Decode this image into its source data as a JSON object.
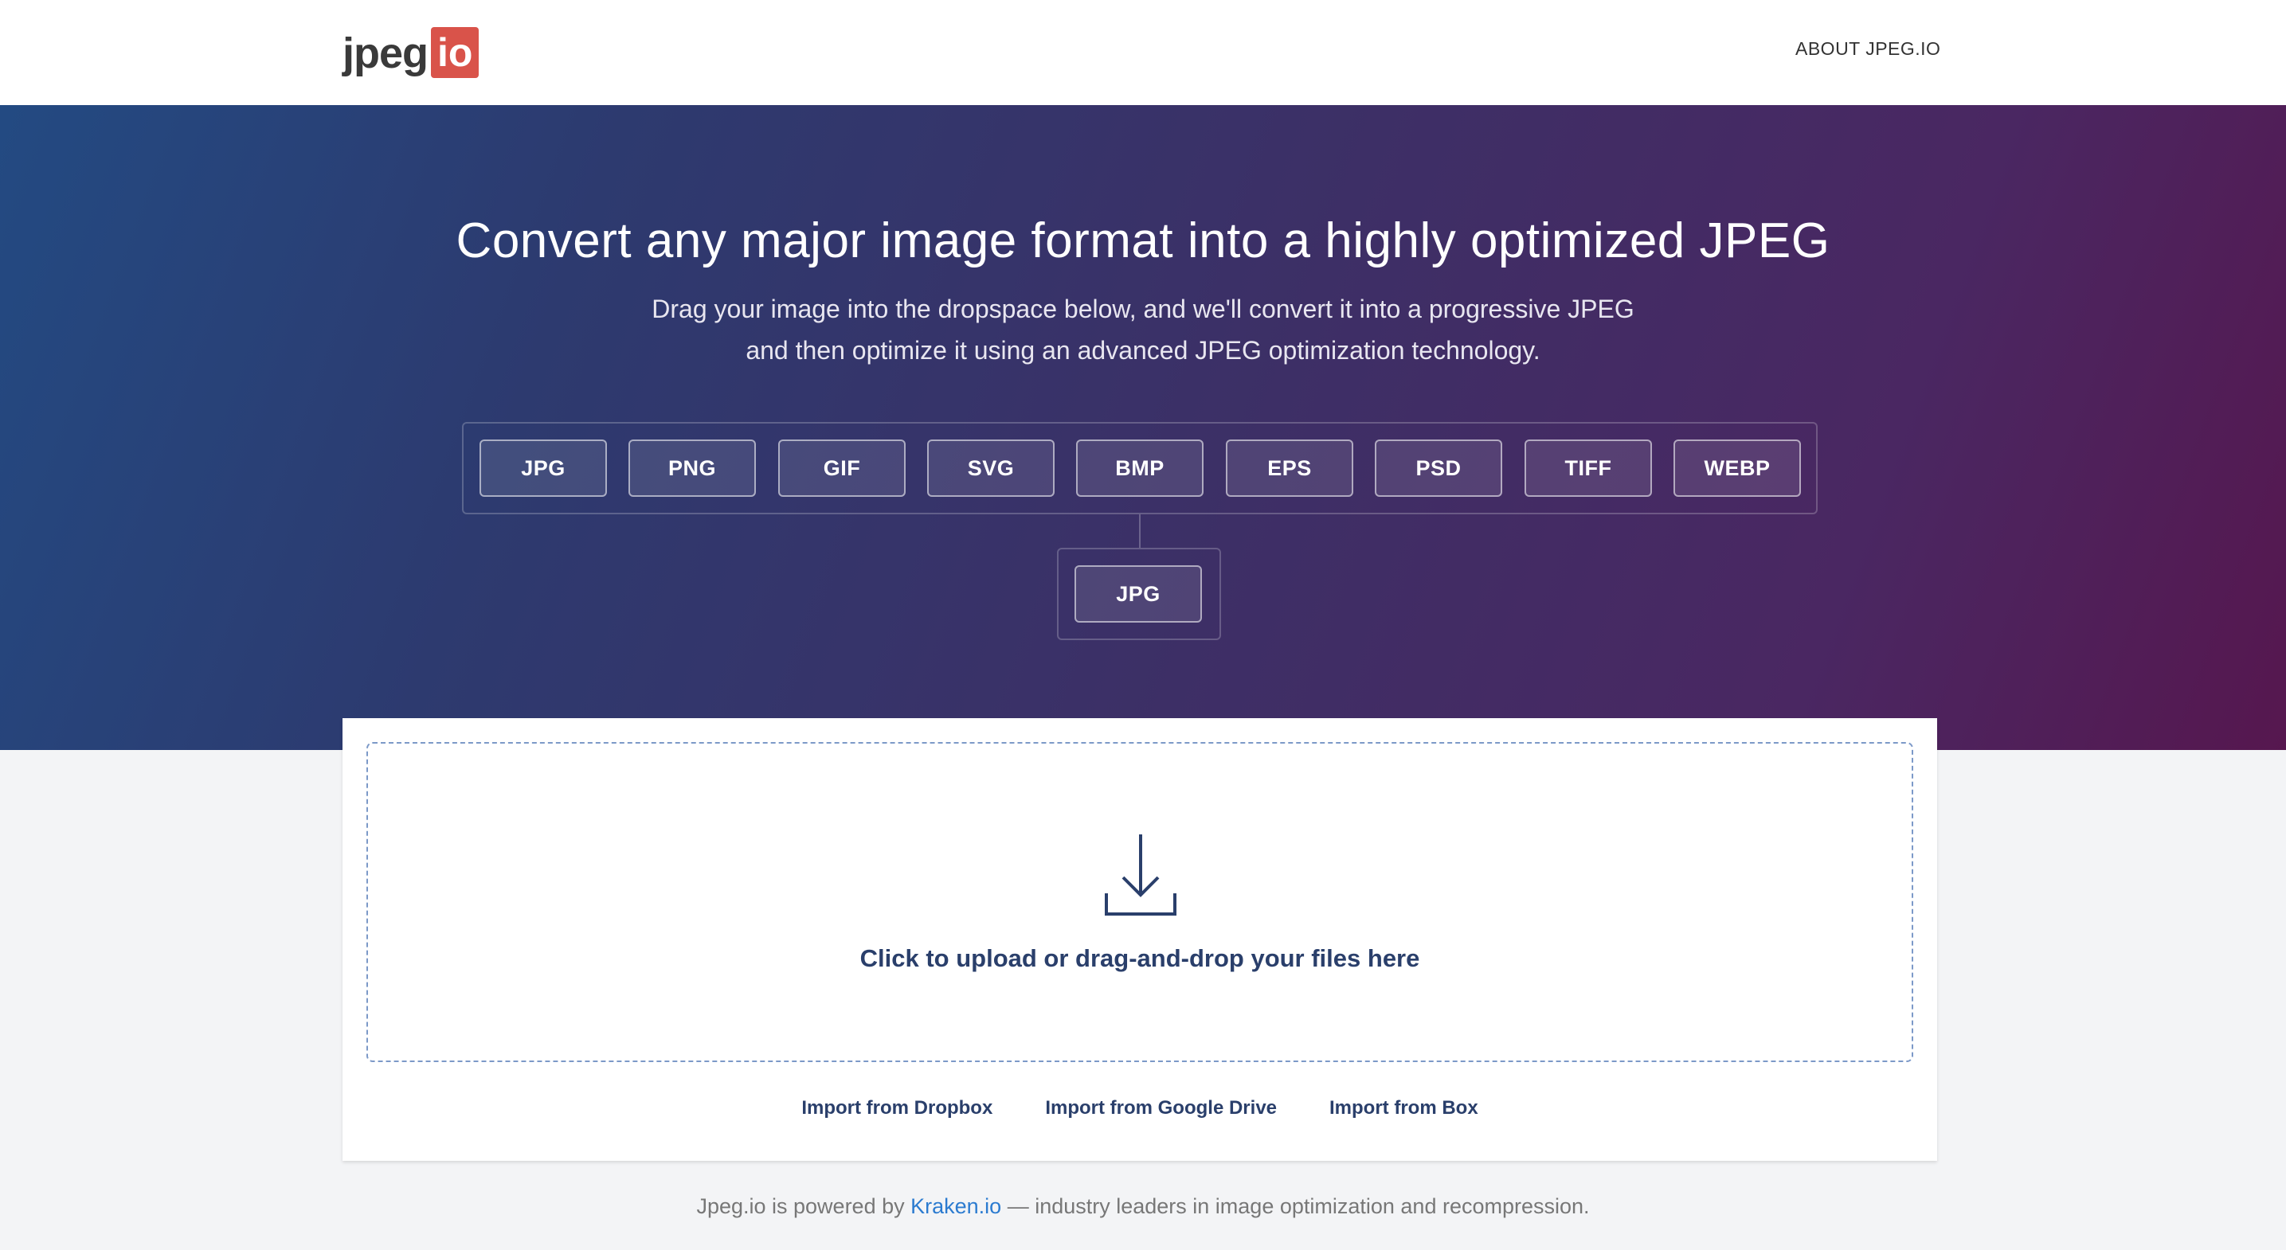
{
  "header": {
    "logo_text": "jpeg",
    "logo_badge": "io",
    "nav_about": "ABOUT JPEG.IO"
  },
  "hero": {
    "title": "Convert any major image format into a highly optimized JPEG",
    "subtitle_line1": "Drag your image into the dropspace below, and we'll convert it into a progressive JPEG",
    "subtitle_line2": "and then optimize it using an advanced JPEG optimization technology.",
    "input_formats": [
      "JPG",
      "PNG",
      "GIF",
      "SVG",
      "BMP",
      "EPS",
      "PSD",
      "TIFF",
      "WEBP"
    ],
    "output_format": "JPG"
  },
  "upload": {
    "icon": "download-arrow-icon",
    "prompt": "Click to upload or drag-and-drop your files here",
    "imports": [
      "Import from Dropbox",
      "Import from Google Drive",
      "Import from Box"
    ]
  },
  "footer": {
    "text_before": "Jpeg.io is powered by ",
    "link_text": "Kraken.io",
    "text_after": " — industry leaders in image optimization and recompression."
  },
  "colors": {
    "logo_badge": "#d9534a",
    "primary_text": "#2a3f6b",
    "link": "#2b7bd0",
    "gradient_start": "#234a82",
    "gradient_end": "#56174f"
  }
}
